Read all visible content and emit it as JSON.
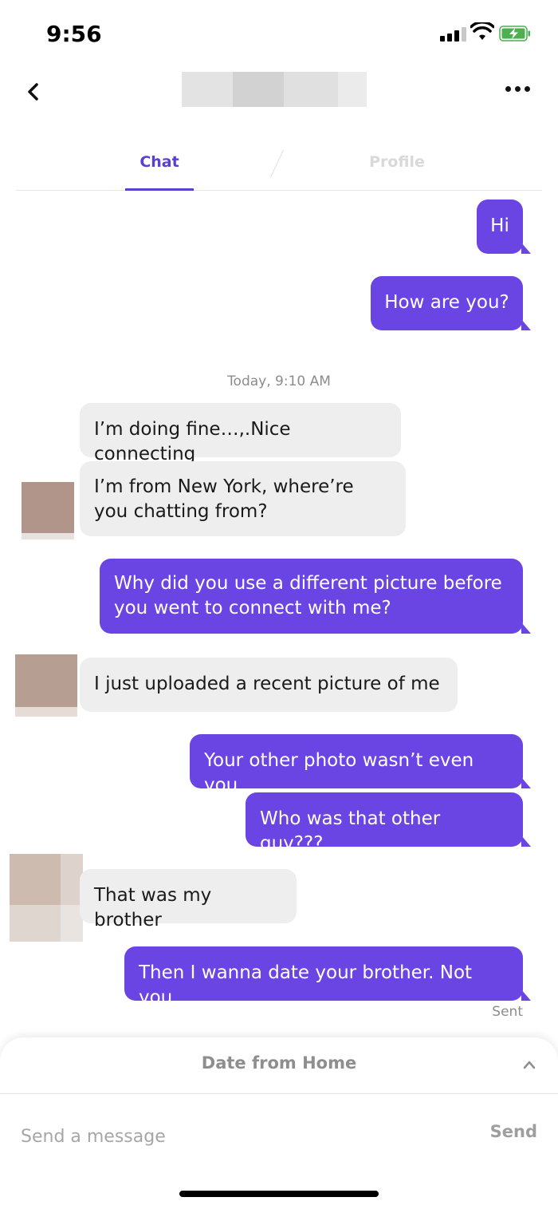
{
  "status_bar": {
    "time": "9:56"
  },
  "header": {
    "contact_name": ""
  },
  "tabs": [
    {
      "label": "Chat",
      "active": true
    },
    {
      "label": "Profile",
      "active": false
    }
  ],
  "messages": [
    {
      "direction": "outgoing",
      "text": "Hi"
    },
    {
      "direction": "outgoing",
      "text": "How are you?"
    },
    {
      "direction": "divider",
      "text": "Today, 9:10 AM"
    },
    {
      "direction": "incoming",
      "text": "I’m doing fine…,.Nice connecting"
    },
    {
      "direction": "incoming",
      "text": "I’m from New York, where’re you chatting from?"
    },
    {
      "direction": "outgoing",
      "text": "Why did you use a different picture before you went to connect with me?"
    },
    {
      "direction": "incoming",
      "text": "I just uploaded a recent picture of me"
    },
    {
      "direction": "outgoing",
      "text": "Your other photo wasn’t even you"
    },
    {
      "direction": "outgoing",
      "text": "Who was that other guy???"
    },
    {
      "direction": "incoming",
      "text": "That was my brother"
    },
    {
      "direction": "outgoing",
      "text": "Then I wanna date your brother. Not you."
    }
  ],
  "delivery_status": "Sent",
  "bottom_panel": {
    "title": "Date from Home",
    "input_placeholder": "Send a message",
    "send_label": "Send"
  },
  "colors": {
    "accent": "#6a45e4",
    "incoming_bubble": "#eeeeee",
    "tab_active": "#5b3fd1"
  },
  "icons": [
    "back-chevron-icon",
    "more-dots-icon",
    "signal-icon",
    "wifi-icon",
    "battery-charging-icon",
    "chevron-up-icon"
  ]
}
